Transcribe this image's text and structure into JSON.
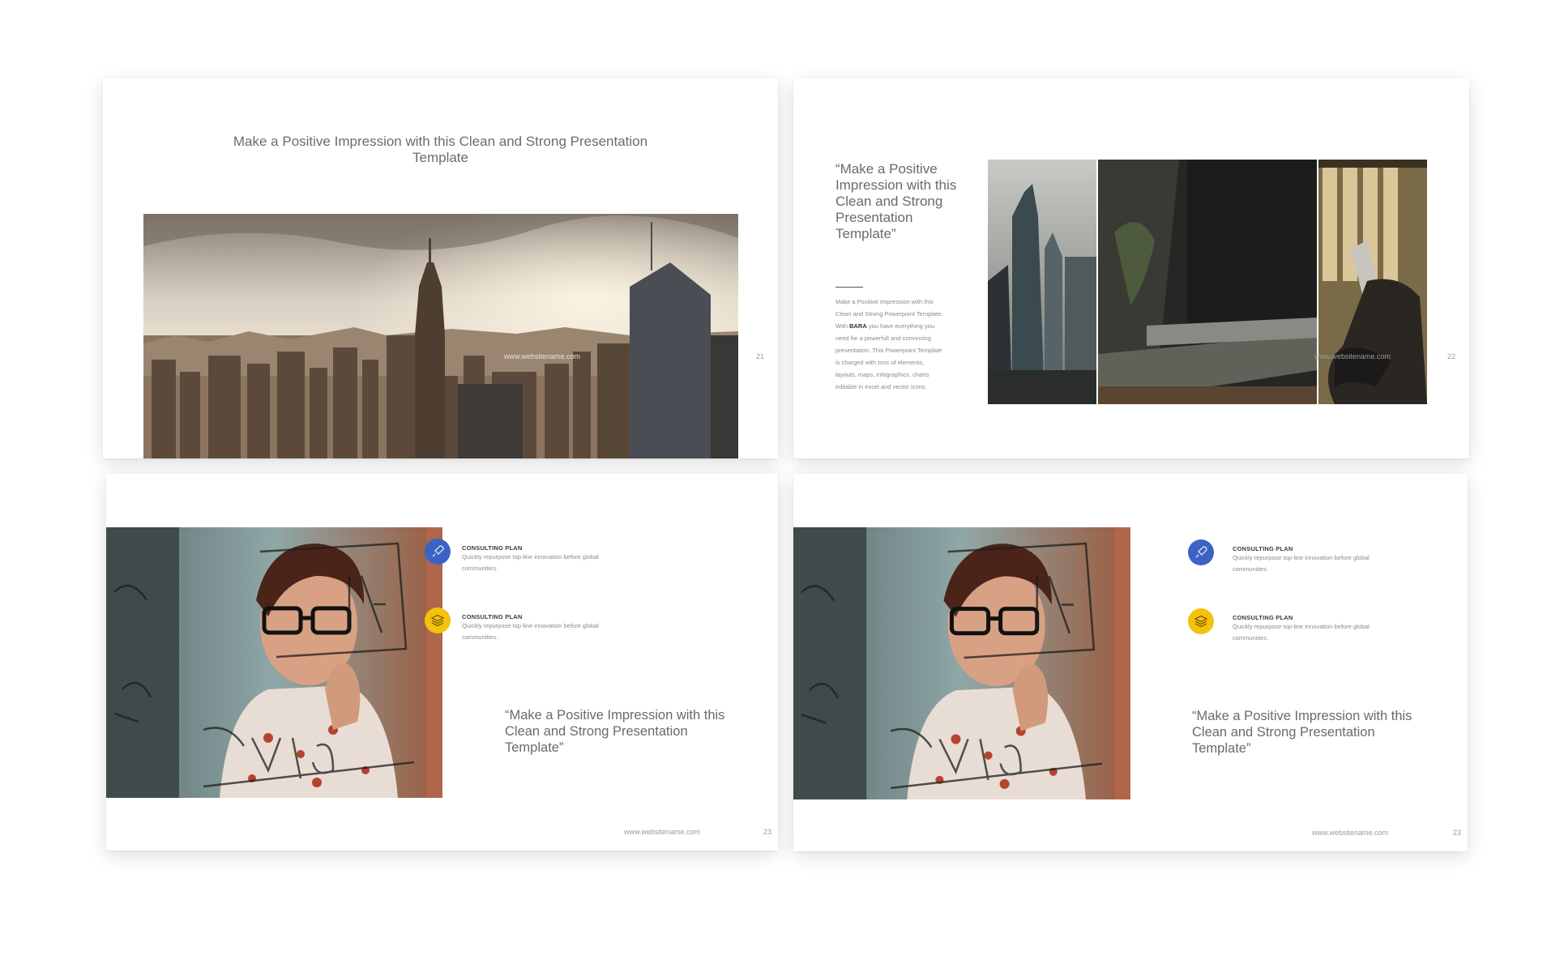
{
  "slides": [
    {
      "id": "slide-21",
      "title": "Make a Positive Impression with this Clean and Strong Presentation Template",
      "website": "www.websitename.com",
      "page_number": "21"
    },
    {
      "id": "slide-22",
      "quote": "“Make a Positive Impression with this Clean and Strong Presentation Template”",
      "body_pre": "Make a Positive Impression with this Clean and Strong Powerpoint Template. With ",
      "body_brand": "BARA",
      "body_post": " you have everything you need for a powerfull and convincing presentation. This Powerpoint Template is charged with tons of elements, layouts, maps, infographics, charts editable in excel and vector icons.",
      "website": "www.websitename.com",
      "page_number": "22"
    },
    {
      "id": "slide-23",
      "features": [
        {
          "title": "CONSULTING PLAN",
          "description": "Quickly repurpose top-line innovation before global communities.",
          "icon": "rocket-icon",
          "color": "#3b63c4"
        },
        {
          "title": "CONSULTING PLAN",
          "description": "Quickly repurpose top-line innovation before global communities.",
          "icon": "layers-icon",
          "color": "#f4c20d"
        }
      ],
      "quote": "“Make a Positive Impression with this Clean and Strong Presentation Template”",
      "website": "www.websitename.com",
      "page_number": "23"
    },
    {
      "id": "slide-23-copy",
      "features": [
        {
          "title": "CONSULTING PLAN",
          "description": "Quickly repurpose top-line innovation before global communities.",
          "icon": "rocket-icon",
          "color": "#3b63c4"
        },
        {
          "title": "CONSULTING PLAN",
          "description": "Quickly repurpose top-line innovation before global communities.",
          "icon": "layers-icon",
          "color": "#f4c20d"
        }
      ],
      "quote": "“Make a Positive Impression with this Clean and Strong Presentation Template”",
      "website": "www.websitename.com",
      "page_number": "23"
    }
  ]
}
